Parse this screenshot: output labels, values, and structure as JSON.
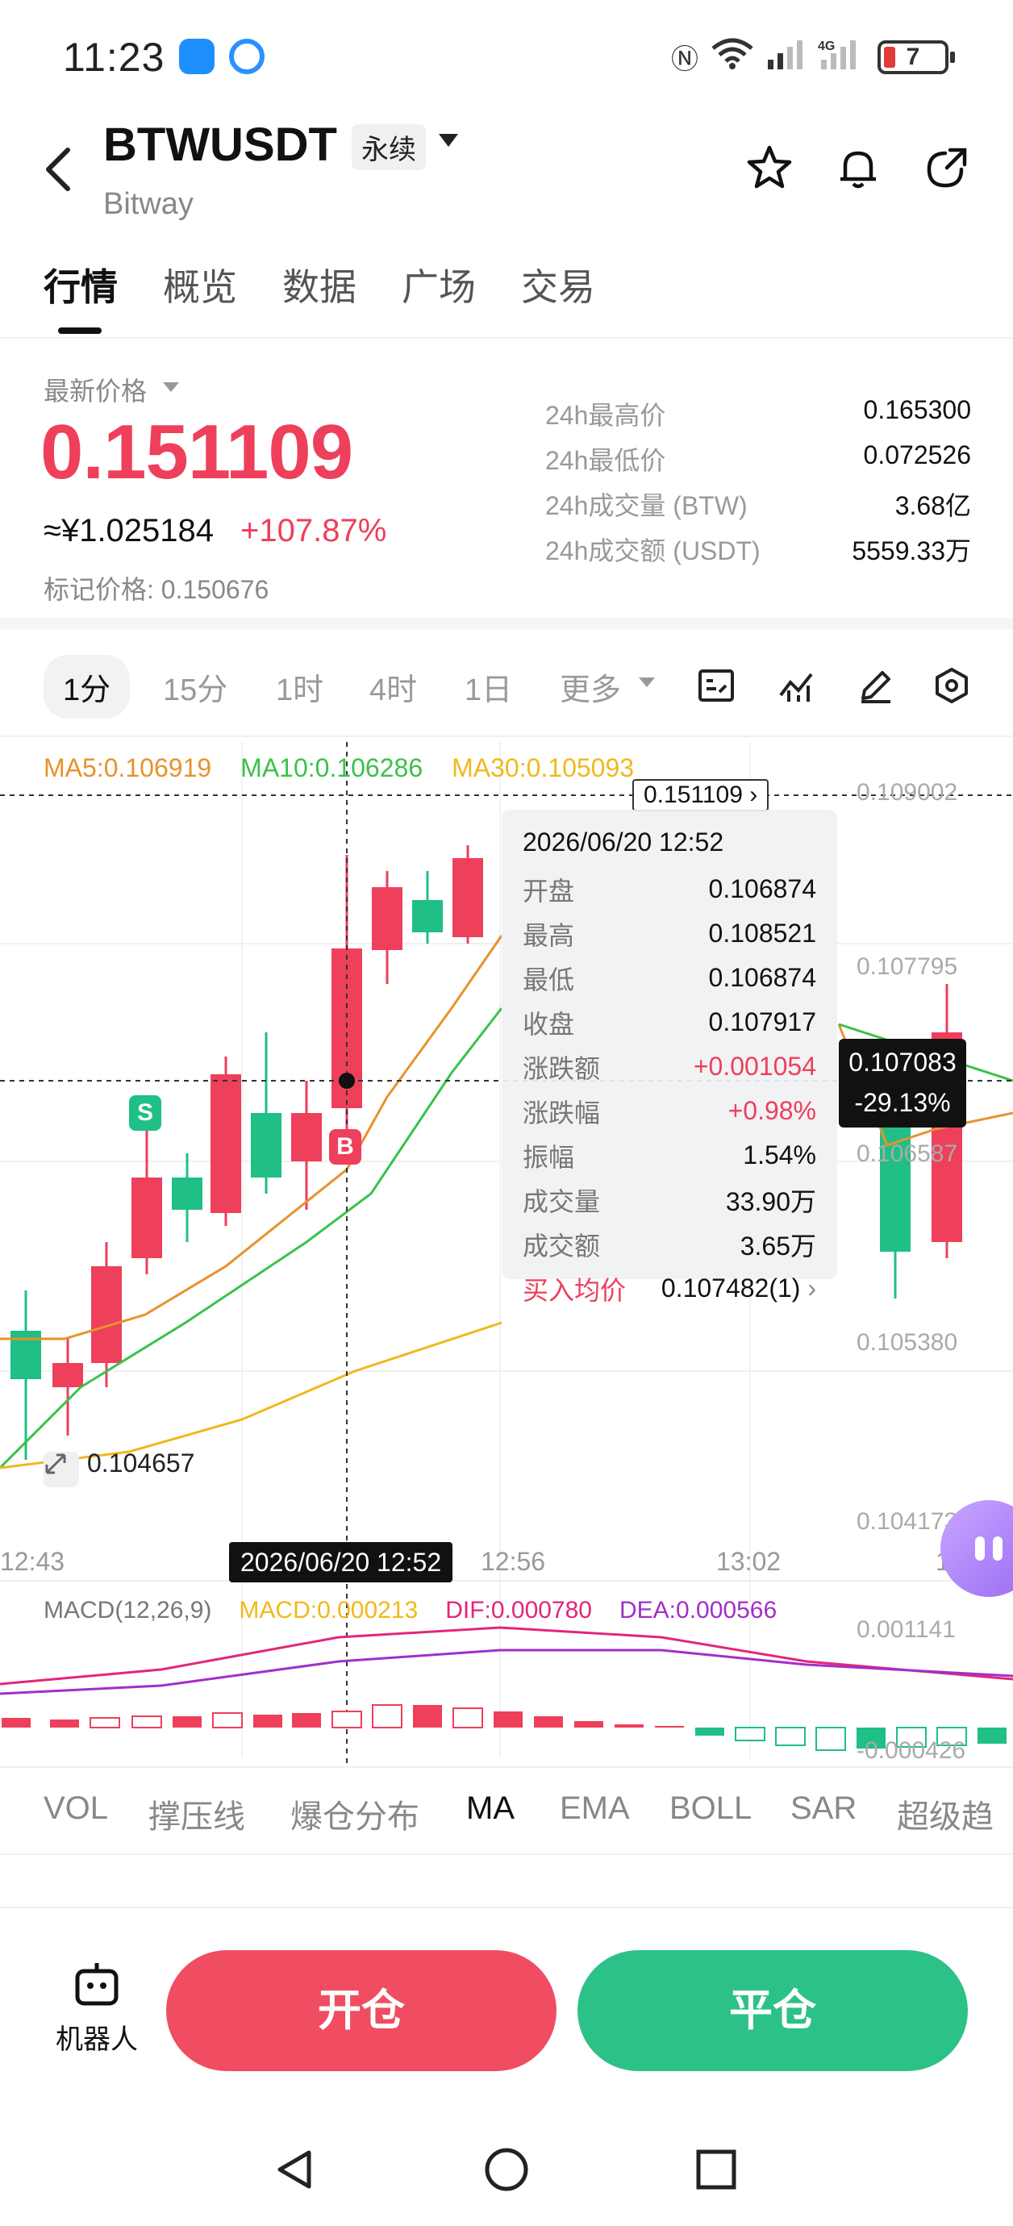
{
  "status_bar": {
    "time": "11:23",
    "battery": "7"
  },
  "header": {
    "symbol": "BTWUSDT",
    "contract_type": "永续",
    "exchange": "Bitway"
  },
  "tabs": [
    "行情",
    "概览",
    "数据",
    "广场",
    "交易"
  ],
  "price": {
    "label": "最新价格",
    "last": "0.151109",
    "cny": "≈¥1.025184",
    "change_pct": "+107.87%",
    "mark_price": "标记价格: 0.150676",
    "stats": [
      {
        "k": "24h最高价",
        "v": "0.165300"
      },
      {
        "k": "24h最低价",
        "v": "0.072526"
      },
      {
        "k": "24h成交量 (BTW)",
        "v": "3.68亿"
      },
      {
        "k": "24h成交额 (USDT)",
        "v": "5559.33万"
      }
    ]
  },
  "intervals": [
    "1分",
    "15分",
    "1时",
    "4时",
    "1日",
    "更多"
  ],
  "chart": {
    "ma5": "MA5:0.106919",
    "ma10": "MA10:0.106286",
    "ma30": "MA30:0.105093",
    "last_price_tag": "0.151109",
    "y_labels": [
      "0.109002",
      "0.107795",
      "0.106587",
      "0.105380",
      "0.104173"
    ],
    "x_labels": [
      "12:43",
      "12:56",
      "13:02",
      "13:08"
    ],
    "crosshair_time": "2026/06/20 12:52",
    "current_price": "0.107083",
    "current_pct": "-29.13%",
    "low_marker": "0.104657",
    "signal_buy": "B",
    "signal_sell": "S",
    "macd_labels": {
      "title": "MACD(12,26,9)",
      "macd": "MACD:0.000213",
      "dif": "DIF:0.000780",
      "dea": "DEA:0.000566"
    },
    "macd_y_labels": [
      "0.001141",
      "-0.000426"
    ],
    "tooltip": {
      "date": "2026/06/20 12:52",
      "rows": [
        {
          "k": "开盘",
          "v": "0.106874"
        },
        {
          "k": "最高",
          "v": "0.108521"
        },
        {
          "k": "最低",
          "v": "0.106874"
        },
        {
          "k": "收盘",
          "v": "0.107917"
        },
        {
          "k": "涨跌额",
          "v": "+0.001054"
        },
        {
          "k": "涨跌幅",
          "v": "+0.98%"
        },
        {
          "k": "振幅",
          "v": "1.54%"
        },
        {
          "k": "成交量",
          "v": "33.90万"
        },
        {
          "k": "成交额",
          "v": "3.65万"
        },
        {
          "k": "买入均价",
          "v": "0.107482(1)"
        }
      ]
    },
    "colors": {
      "up": "#ee3f5b",
      "down": "#1fbf86",
      "ma5": "#e8922c",
      "ma10": "#3ac24a",
      "ma30": "#f0b81c"
    }
  },
  "indicators": [
    "VOL",
    "撑压线",
    "爆仓分布",
    "MA",
    "EMA",
    "BOLL",
    "SAR",
    "超级趋"
  ],
  "actions": {
    "robot": "机器人",
    "open": "开仓",
    "close": "平仓"
  }
}
